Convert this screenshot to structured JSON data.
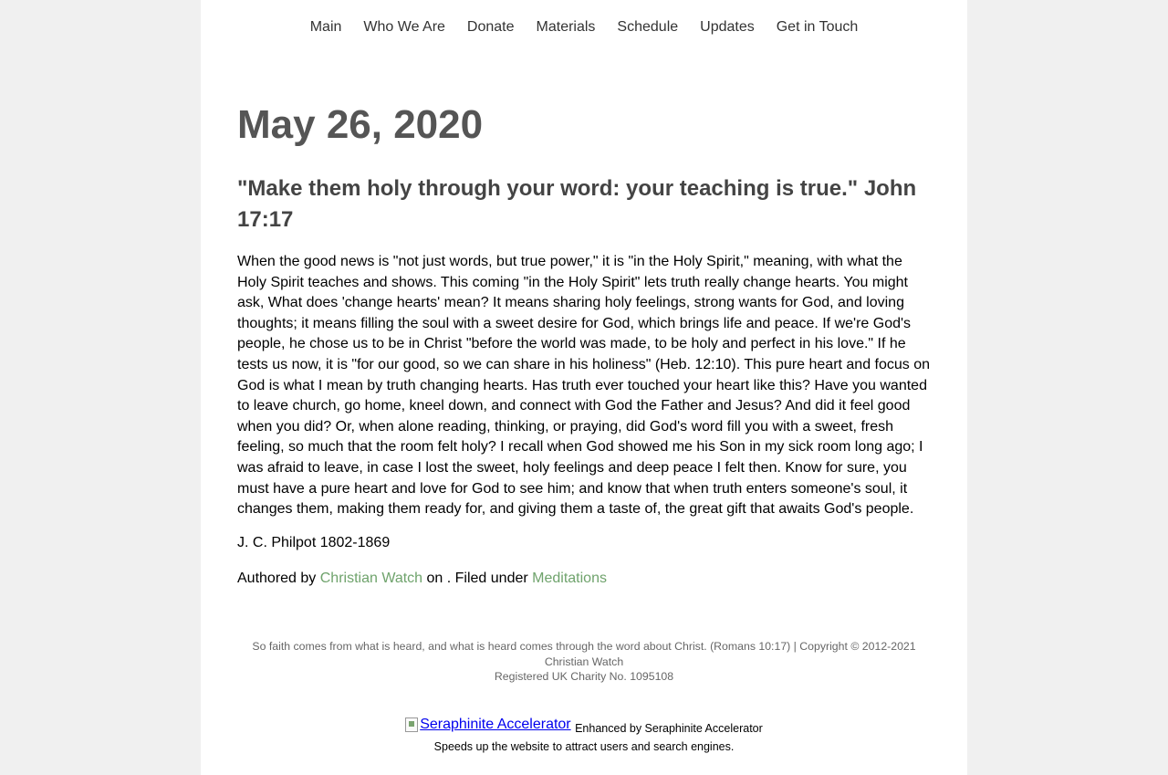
{
  "nav": {
    "items": [
      "Main",
      "Who We Are",
      "Donate",
      "Materials",
      "Schedule",
      "Updates",
      "Get in Touch"
    ]
  },
  "post": {
    "title": "May 26, 2020",
    "subtitle": "\"Make them holy through your word: your teaching is true.\" John 17:17",
    "body": "When the good news is \"not just words, but true power,\" it is \"in the Holy Spirit,\" meaning, with what the Holy Spirit teaches and shows. This coming \"in the Holy Spirit\" lets truth really change hearts. You might ask, What does 'change hearts' mean? It means sharing holy feelings, strong wants for God, and loving thoughts; it means filling the soul with a sweet desire for God, which brings life and peace. If we're God's people, he chose us to be in Christ \"before the world was made, to be holy and perfect in his love.\" If he tests us now, it is \"for our good, so we can share in his holiness\" (Heb. 12:10). This pure heart and focus on God is what I mean by truth changing hearts. Has truth ever touched your heart like this? Have you wanted to leave church, go home, kneel down, and connect with God the Father and Jesus? And did it feel good when you did? Or, when alone reading, thinking, or praying, did God's word fill you with a sweet, fresh feeling, so much that the room felt holy? I recall when God showed me his Son in my sick room long ago; I was afraid to leave, in case I lost the sweet, holy feelings and deep peace I felt then. Know for sure, you must have a pure heart and love for God to see him; and know that when truth enters someone's soul, it changes them, making them ready for, and giving them a taste of, the great gift that awaits God's people.",
    "attribution": "J. C. Philpot 1802-1869",
    "meta": {
      "authored_prefix": "Authored by ",
      "author": "Christian Watch",
      "on_text": " on . Filed under ",
      "category": "Meditations"
    }
  },
  "footer": {
    "line1": "So faith comes from what is heard, and what is heard comes through the word about Christ. (Romans 10:17) | Copyright © 2012-2021 Christian Watch",
    "line2": "Registered UK Charity No. 1095108"
  },
  "badge": {
    "image_alt": "Seraphinite Accelerator",
    "enhanced": "Enhanced by Seraphinite Accelerator",
    "tagline": "Speeds up the website to attract users and search engines."
  },
  "colors": {
    "link": "#6fa36c",
    "heading": "#555555",
    "background": "#f0f0f0"
  }
}
